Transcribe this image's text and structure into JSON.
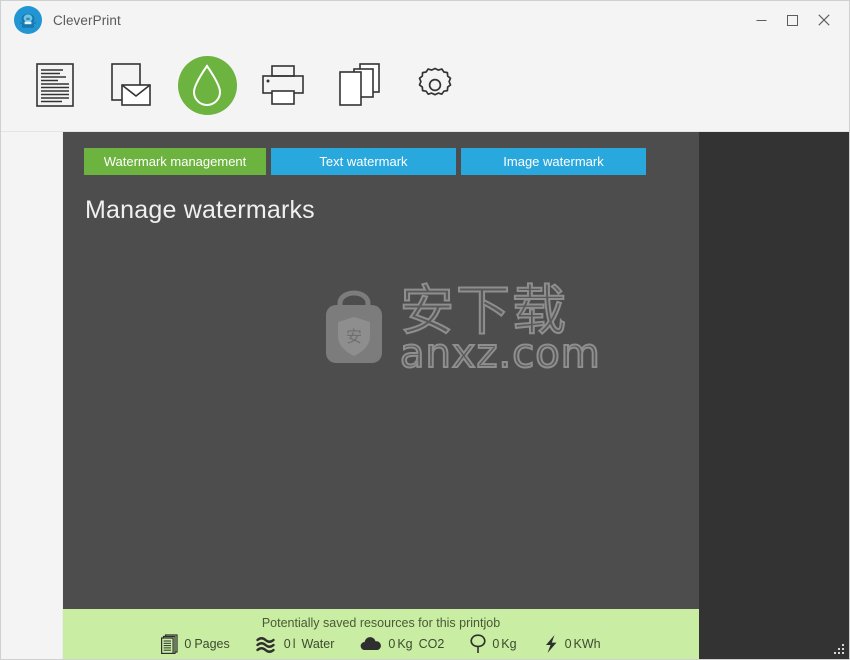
{
  "window": {
    "title": "CleverPrint",
    "logo_icon": "cleverprint-logo-icon",
    "controls": {
      "minimize": "minimize-icon",
      "maximize": "maximize-icon",
      "close": "close-icon"
    }
  },
  "toolbar": {
    "items": [
      {
        "name": "document",
        "icon": "document-lines-icon",
        "active": false
      },
      {
        "name": "mail",
        "icon": "envelope-document-icon",
        "active": false
      },
      {
        "name": "watermark",
        "icon": "water-droplet-icon",
        "active": true
      },
      {
        "name": "printer",
        "icon": "printer-icon",
        "active": false
      },
      {
        "name": "copies",
        "icon": "multiple-pages-icon",
        "active": false
      },
      {
        "name": "settings",
        "icon": "gear-icon",
        "active": false
      }
    ]
  },
  "main": {
    "tabs": [
      {
        "label": "Watermark management",
        "active": true
      },
      {
        "label": "Text watermark",
        "active": false
      },
      {
        "label": "Image watermark",
        "active": false
      }
    ],
    "page_title": "Manage watermarks"
  },
  "site_watermark": {
    "cn_text": "安下载",
    "domain": "anxz.com",
    "badge_char": "安",
    "icon": "shopping-bag-shield-icon"
  },
  "statusbar": {
    "heading": "Potentially saved resources for this printjob",
    "items": [
      {
        "icon": "pages-icon",
        "value": "0",
        "unit": "Pages",
        "extra": ""
      },
      {
        "icon": "water-waves-icon",
        "value": "0",
        "unit": "l",
        "extra": "Water"
      },
      {
        "icon": "cloud-icon",
        "value": "0",
        "unit": "Kg",
        "extra": "CO2"
      },
      {
        "icon": "tree-icon",
        "value": "0",
        "unit": "Kg",
        "extra": ""
      },
      {
        "icon": "lightning-icon",
        "value": "0",
        "unit": "KWh",
        "extra": ""
      }
    ]
  },
  "colors": {
    "accent_green": "#6cb33f",
    "accent_blue": "#29a8dd",
    "status_bg": "#c9eda2",
    "content_bg": "#4d4d4d",
    "right_rail_bg": "#333333",
    "chrome_bg": "#f4f4f4",
    "logo_blue": "#2196d3"
  }
}
